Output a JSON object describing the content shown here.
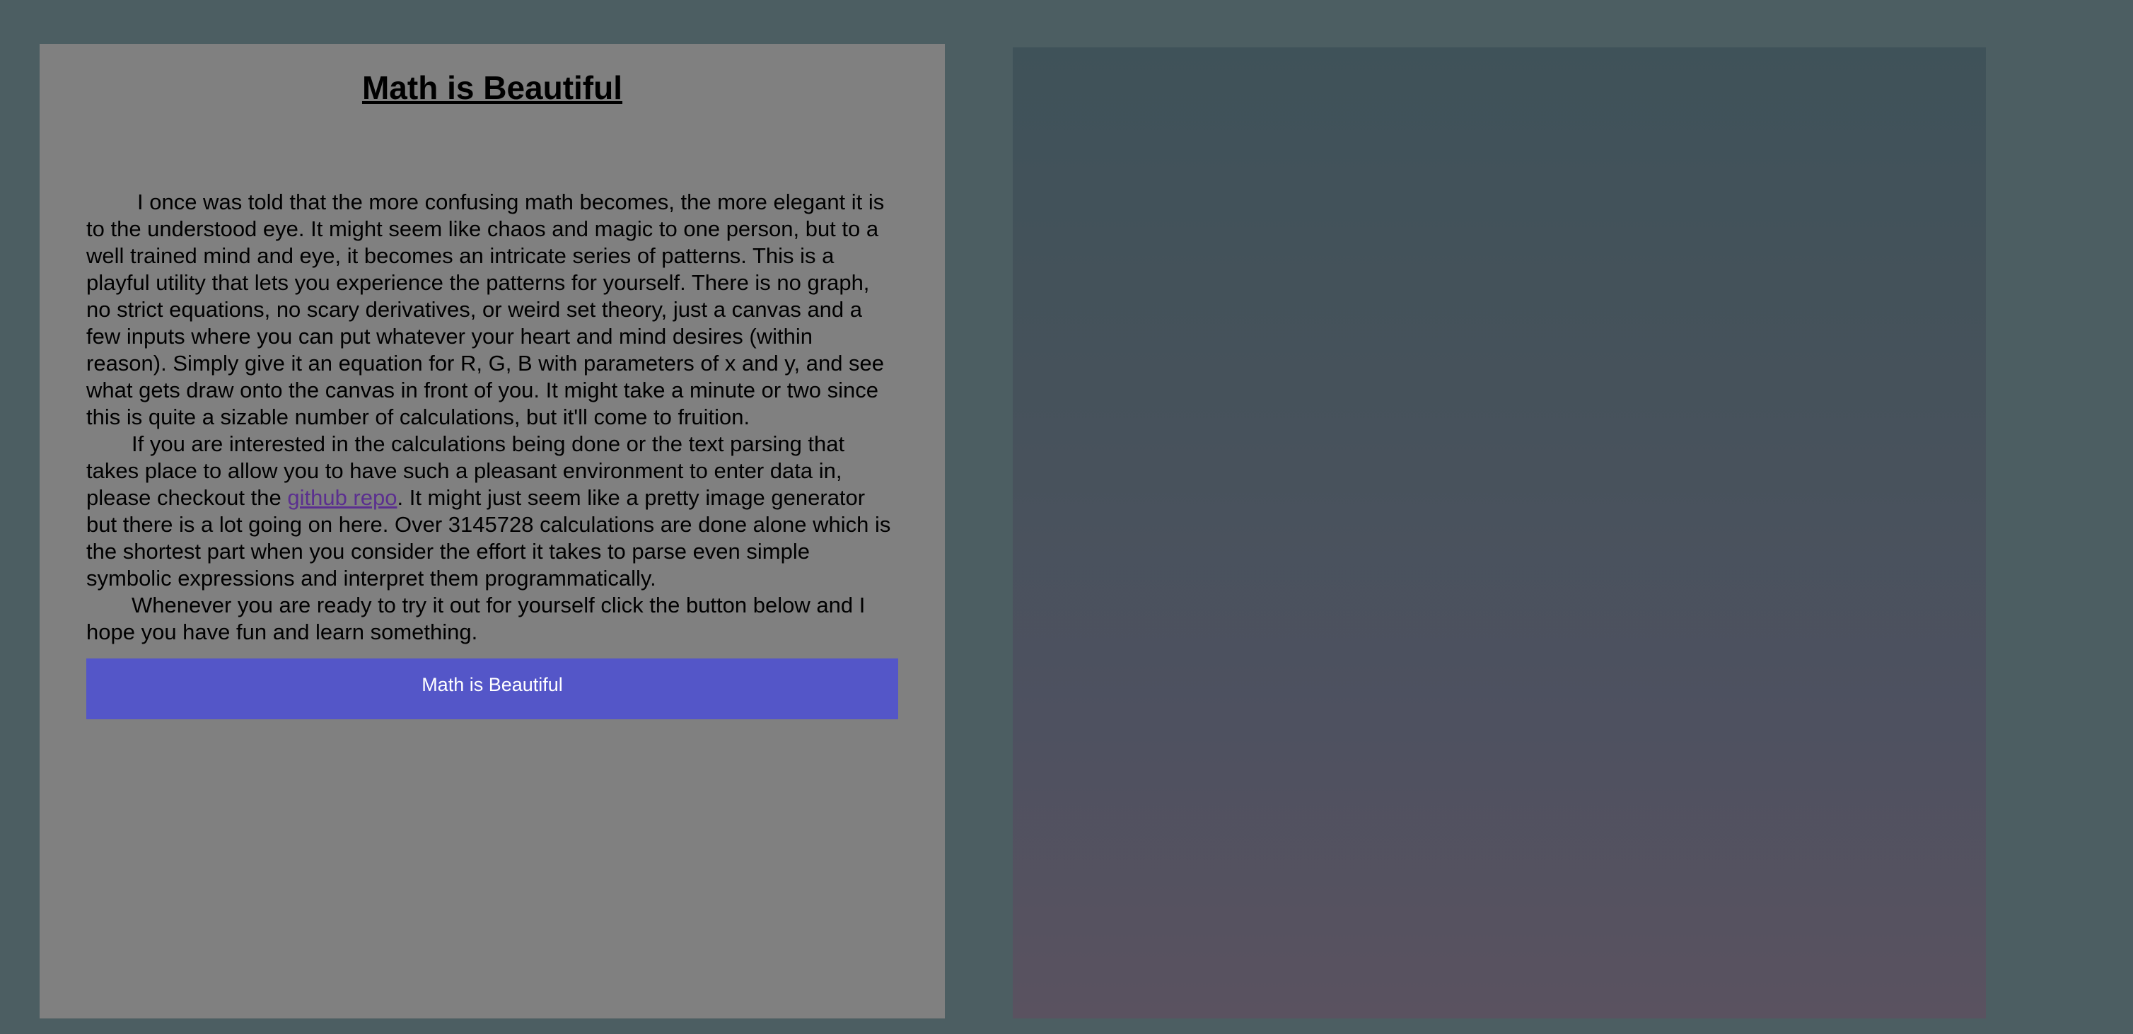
{
  "intro": {
    "title": "Math is Beautiful",
    "paragraph1": "I once was told that the more confusing math becomes, the more elegant it is to the understood eye. It might seem like chaos and magic to one person, but to a well trained mind and eye, it becomes an intricate series of patterns. This is a playful utility that lets you experience the patterns for yourself. There is no graph, no strict equations, no scary derivatives, or weird set theory, just a canvas and a few inputs where you can put whatever your heart and mind desires (within reason). Simply give it an equation for R, G, B with parameters of x and y, and see what gets draw onto the canvas in front of you. It might take a minute or two since this is quite a sizable number of calculations, but it'll come to fruition.",
    "paragraph2_before_link": "If you are interested in the calculations being done or the text parsing that takes place to allow you to have such a pleasant environment to enter data in, please checkout the ",
    "repo_link_text": "github repo",
    "paragraph2_after_link": ". It might just seem like a pretty image generator but there is a lot going on here. Over 3145728 calculations are done alone which is the shortest part when you consider the effort it takes to parse even simple symbolic expressions and interpret them programmatically.",
    "paragraph3": "Whenever you are ready to try it out for yourself click the button below and I hope you have fun and learn something.",
    "button_label": "Math is Beautiful"
  },
  "colors": {
    "page_background": "#4c5e62",
    "panel_background": "#808080",
    "button_background": "#5456c8",
    "link_color": "#5b2f8f",
    "canvas_top": "#3f5259",
    "canvas_bottom": "#5a5260"
  }
}
